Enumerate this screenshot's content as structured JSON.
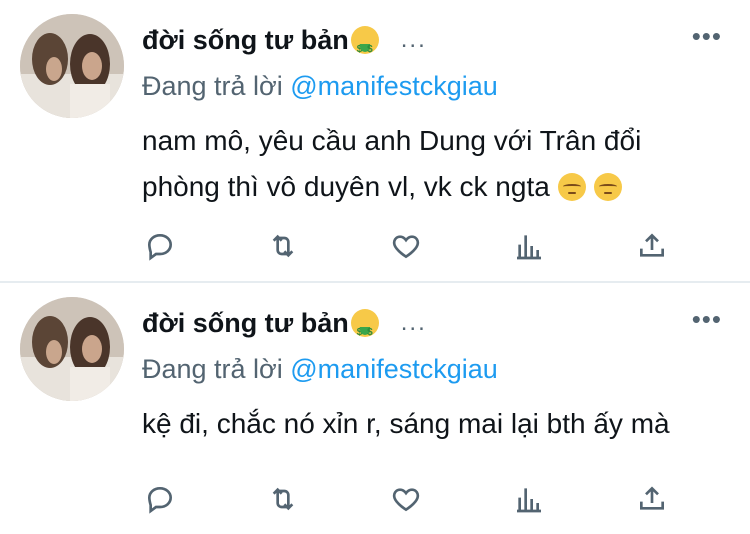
{
  "tweets": [
    {
      "author": "đời sống tư bản",
      "inline_more": "...",
      "more": "•••",
      "reply_prefix": "Đang trả lời ",
      "reply_handle": "@manifestckgiau",
      "text": "nam mô, yêu cầu anh Dung với Trân đổi phòng thì vô duyên vl, vk ck ngta",
      "icons": [
        "reply-icon",
        "retweet-icon",
        "like-icon",
        "stats-icon",
        "share-icon"
      ]
    },
    {
      "author": "đời sống tư bản",
      "inline_more": "...",
      "more": "•••",
      "reply_prefix": "Đang trả lời ",
      "reply_handle": "@manifestckgiau",
      "text": "kệ đi, chắc nó xỉn r, sáng mai lại bth ấy mà",
      "icons": [
        "reply-icon",
        "retweet-icon",
        "like-icon",
        "stats-icon",
        "share-icon"
      ]
    }
  ],
  "colors": {
    "link": "#1d9bf0",
    "muted": "#536471",
    "text": "#0f1419",
    "separator": "#e6ecf0"
  }
}
